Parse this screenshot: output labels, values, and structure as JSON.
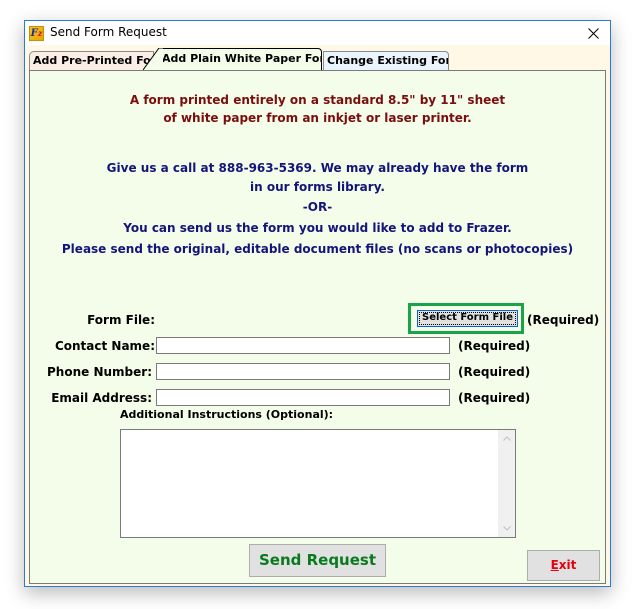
{
  "window": {
    "title": "Send Form Request",
    "icon": "frazer-ez-app-icon",
    "close_icon": "close-x-icon"
  },
  "tabs": [
    {
      "label": "Add Pre-Printed Form",
      "active": false
    },
    {
      "label": "Add Plain White Paper Form",
      "active": true
    },
    {
      "label": "Change Existing Form",
      "active": false
    }
  ],
  "intro": {
    "line1": "A form printed entirely on a standard 8.5\" by 11\" sheet",
    "line2": "of white paper from an inkjet or laser printer.",
    "color": "#7a0e0e"
  },
  "contact_info": {
    "line1": "Give us a call at 888-963-5369.  We may already have the form",
    "line2": "in our forms library.",
    "line3": "-OR-",
    "line4": "You can send us the form you would like to add to Frazer.",
    "line5": "Please send the original, editable document files (no scans or photocopies)",
    "color": "#14147a"
  },
  "form": {
    "form_file": {
      "label": "Form File:",
      "button": "Select Form File",
      "required": "(Required)"
    },
    "contact_name": {
      "label": "Contact Name:",
      "value": "",
      "required": "(Required)"
    },
    "phone_number": {
      "label": "Phone Number:",
      "value": "",
      "required": "(Required)"
    },
    "email_address": {
      "label": "Email Address:",
      "value": "",
      "required": "(Required)"
    },
    "additional": {
      "label": "Additional Instructions (Optional):",
      "value": ""
    }
  },
  "buttons": {
    "send": "Send Request",
    "exit_mnemonic": "E",
    "exit_rest": "xit"
  },
  "colors": {
    "panel_bg": "#f4fde9",
    "highlight": "#1aa34a",
    "send_text": "#0a7a1e",
    "exit_text": "#e8000e"
  }
}
